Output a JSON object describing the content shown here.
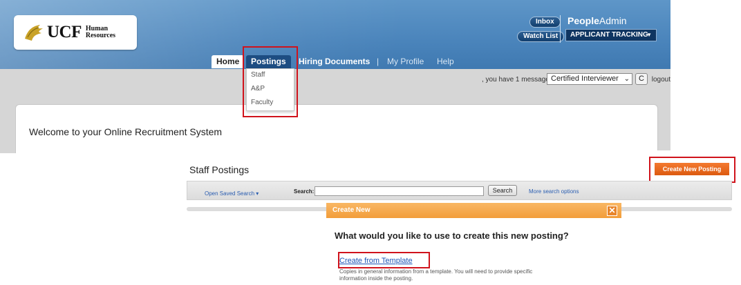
{
  "header": {
    "logo_text": "UCF",
    "logo_sub_line1": "Human",
    "logo_sub_line2": "Resources",
    "inbox_label": "Inbox",
    "watchlist_label": "Watch List",
    "brand_bold": "People",
    "brand_light": "Admin",
    "product_select": "APPLICANT TRACKING",
    "colors": {
      "header_blue": "#4a84bb",
      "tab_active": "#1d4d82"
    }
  },
  "nav": {
    "tabs": [
      {
        "label": "Home"
      },
      {
        "label": "Postings"
      },
      {
        "label": "Hiring Documents"
      },
      {
        "label": "|"
      },
      {
        "label": "My Profile"
      },
      {
        "label": "Help"
      }
    ],
    "postings_menu": [
      "Staff",
      "A&P",
      "Faculty"
    ]
  },
  "userbar": {
    "message": ", you have 1 message.",
    "role_select": "Certified Interviewer",
    "refresh_icon": "C",
    "logout": "logout"
  },
  "welcome": {
    "text": "Welcome to your Online Recruitment System"
  },
  "staff_postings": {
    "title": "Staff Postings",
    "create_button": "Create New Posting",
    "open_saved_search": "Open Saved Search ▾",
    "search_label": "Search:",
    "search_value": "",
    "search_button": "Search",
    "more_options": "More search options"
  },
  "modal": {
    "title": "Create New",
    "close": "✕",
    "question": "What would you like to use to create this new posting?",
    "template_link": "Create from Template",
    "template_desc_line1": "Copies in general information from a template. You will need to provide specific",
    "template_desc_line2": "information inside the posting.",
    "colors": {
      "header_orange": "#f29d3a",
      "highlight_red": "#d0121b"
    }
  }
}
